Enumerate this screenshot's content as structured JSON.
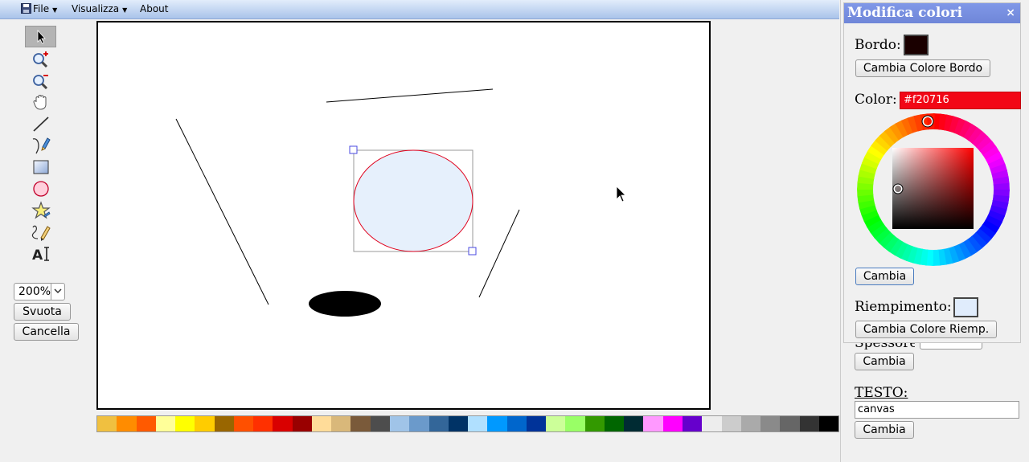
{
  "menubar": {
    "file_label": "File",
    "view_label": "Visualizza",
    "about_label": "About"
  },
  "tools": [
    {
      "name": "select-tool",
      "icon": "pointer-icon",
      "active": true
    },
    {
      "name": "zoom-in-tool",
      "icon": "zoom-in-icon"
    },
    {
      "name": "zoom-out-tool",
      "icon": "zoom-out-icon"
    },
    {
      "name": "pan-tool",
      "icon": "hand-icon"
    },
    {
      "name": "line-tool",
      "icon": "line-icon"
    },
    {
      "name": "path-tool",
      "icon": "path-pen-icon"
    },
    {
      "name": "rect-tool",
      "icon": "rectangle-icon"
    },
    {
      "name": "ellipse-tool",
      "icon": "ellipse-icon"
    },
    {
      "name": "star-tool",
      "icon": "star-icon"
    },
    {
      "name": "freehand-tool",
      "icon": "pencil-icon"
    },
    {
      "name": "text-tool",
      "icon": "text-icon"
    }
  ],
  "left_controls": {
    "zoom_value": "200%",
    "clear_label": "Svuota",
    "delete_label": "Cancella"
  },
  "palette": [
    "#f0c040",
    "#ff8c00",
    "#ff5a00",
    "#ffff99",
    "#ffff00",
    "#ffcc00",
    "#996600",
    "#ff5000",
    "#ff3000",
    "#d90000",
    "#990000",
    "#ffdc99",
    "#d9b87a",
    "#7a5a3a",
    "#4d4d4d",
    "#a0c4e8",
    "#6b9acb",
    "#336699",
    "#003366",
    "#b0e0ff",
    "#0099ff",
    "#0066cc",
    "#003399",
    "#ccff99",
    "#99ff66",
    "#339900",
    "#006600",
    "#002b33",
    "#ff99ff",
    "#ff00ff",
    "#6600cc",
    "#ededed",
    "#cccccc",
    "#aaaaaa",
    "#8a8a8a",
    "#666666",
    "#333333",
    "#000000"
  ],
  "dialog": {
    "title": "Modifica colori",
    "close_label": "×",
    "border_label": "Bordo:",
    "border_color": "#1a0000",
    "change_border_label": "Cambia Colore Bordo",
    "color_label": "Color:",
    "color_value": "#f20716",
    "apply_label": "Cambia",
    "fill_label": "Riempimento:",
    "fill_color": "#e0ecfc",
    "change_fill_label": "Cambia Colore Riemp."
  },
  "side_panel": {
    "stroke_apply_label": "Cambia",
    "text_label": "TESTO:",
    "text_value": "canvas",
    "text_apply_label": "Cambia"
  }
}
